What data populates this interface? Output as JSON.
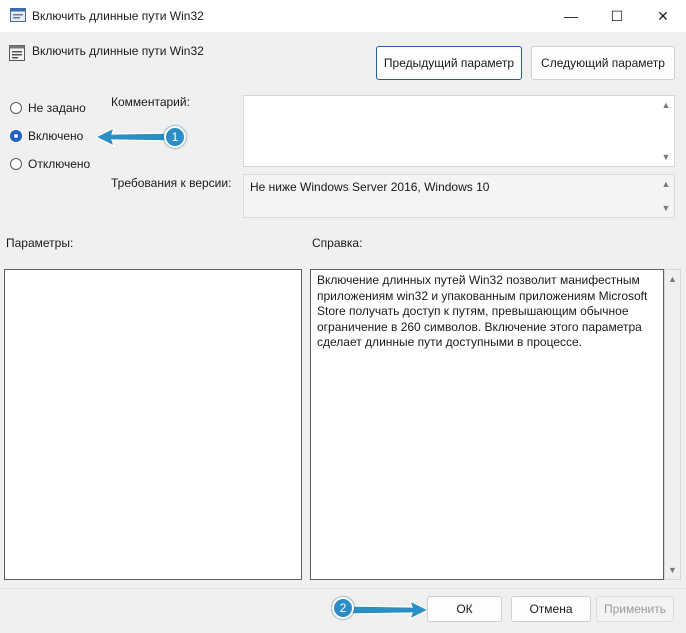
{
  "window": {
    "title": "Включить длинные пути Win32",
    "minimize": "—",
    "maximize": "☐",
    "close": "✕"
  },
  "header": {
    "title": "Включить длинные пути Win32",
    "prev_label": "Предыдущий параметр",
    "next_label": "Следующий параметр"
  },
  "state": {
    "options": [
      {
        "label": "Не задано",
        "checked": false
      },
      {
        "label": "Включено",
        "checked": true
      },
      {
        "label": "Отключено",
        "checked": false
      }
    ]
  },
  "comment": {
    "label": "Комментарий:",
    "value": ""
  },
  "requirements": {
    "label": "Требования к версии:",
    "value": "Не ниже Windows Server 2016, Windows 10"
  },
  "options_panel": {
    "label": "Параметры:"
  },
  "help_panel": {
    "label": "Справка:",
    "text": "Включение длинных путей Win32 позволит манифестным приложениям win32 и упакованным приложениям Microsoft Store получать доступ к путям, превышающим обычное ограничение в 260 символов. Включение этого параметра сделает длинные пути доступными в процессе."
  },
  "footer": {
    "ok_label": "ОК",
    "cancel_label": "Отмена",
    "apply_label": "Применить"
  },
  "annotations": {
    "badge1": "1",
    "badge2": "2"
  },
  "colors": {
    "accent": "#1f5fbf",
    "badge": "#2b8fc6"
  }
}
